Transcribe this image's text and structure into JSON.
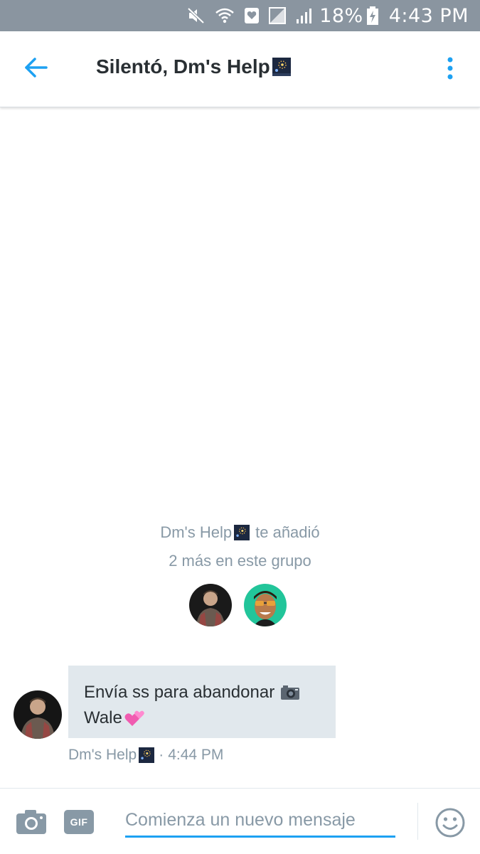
{
  "status_bar": {
    "battery": "18%",
    "time": "4:43 PM",
    "icons": [
      "mute-icon",
      "wifi-icon",
      "heart-notification-icon",
      "no-sim-icon",
      "signal-icon",
      "battery-charging-icon"
    ]
  },
  "header": {
    "title": "Silentó, Dm's Help",
    "back_icon": "arrow-left-icon",
    "more_icon": "more-vertical-icon",
    "accent_color": "#1da1f2"
  },
  "system_message": {
    "actor": "Dm's Help",
    "action": "te añadió",
    "line2": "2 más en este grupo"
  },
  "messages": [
    {
      "sender": "Dm's Help",
      "line1": "Envía ss para abandonar",
      "line2": "Wale",
      "time": "4:44 PM",
      "separator": "·"
    }
  ],
  "composer": {
    "placeholder": "Comienza un nuevo mensaje",
    "gif_label": "GIF",
    "camera_icon": "camera-icon",
    "emoji_icon": "smiley-icon"
  },
  "colors": {
    "status_bar_bg": "#8a95a0",
    "bubble_bg": "#e1e8ed",
    "muted_text": "#8899a6",
    "accent": "#1da1f2"
  }
}
